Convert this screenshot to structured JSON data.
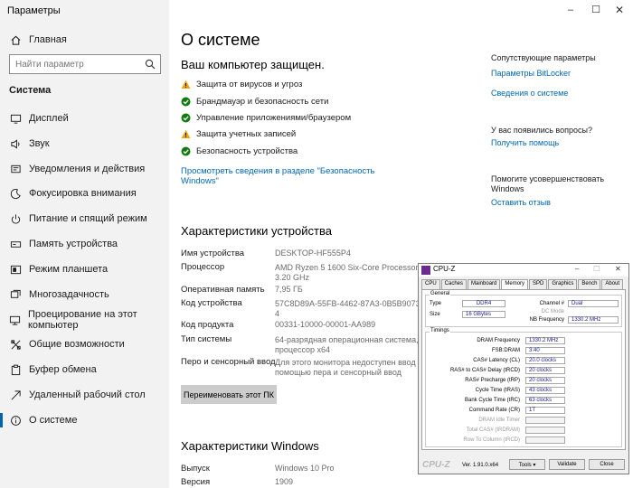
{
  "window": {
    "title": "Параметры",
    "min": "–",
    "max": "☐",
    "close": "✕"
  },
  "sidebar": {
    "home": "Главная",
    "search_placeholder": "Найти параметр",
    "section": "Система",
    "items": [
      {
        "label": "Дисплей",
        "icon": "display-icon"
      },
      {
        "label": "Звук",
        "icon": "sound-icon"
      },
      {
        "label": "Уведомления и действия",
        "icon": "notifications-icon"
      },
      {
        "label": "Фокусировка внимания",
        "icon": "focus-assist-icon"
      },
      {
        "label": "Питание и спящий режим",
        "icon": "power-icon"
      },
      {
        "label": "Память устройства",
        "icon": "storage-icon"
      },
      {
        "label": "Режим планшета",
        "icon": "tablet-mode-icon"
      },
      {
        "label": "Многозадачность",
        "icon": "multitasking-icon"
      },
      {
        "label": "Проецирование на этот компьютер",
        "icon": "projecting-icon"
      },
      {
        "label": "Общие возможности",
        "icon": "shared-experiences-icon"
      },
      {
        "label": "Буфер обмена",
        "icon": "clipboard-icon"
      },
      {
        "label": "Удаленный рабочий стол",
        "icon": "remote-desktop-icon"
      },
      {
        "label": "О системе",
        "icon": "about-icon"
      }
    ]
  },
  "main": {
    "title": "О системе",
    "protected_heading": "Ваш компьютер защищен.",
    "protection": [
      {
        "label": "Защита от вирусов и угроз",
        "status": "warning"
      },
      {
        "label": "Брандмауэр и безопасность сети",
        "status": "ok"
      },
      {
        "label": "Управление приложениями/браузером",
        "status": "ok"
      },
      {
        "label": "Защита учетных записей",
        "status": "warning"
      },
      {
        "label": "Безопасность устройства",
        "status": "ok"
      }
    ],
    "security_link_line1": "Просмотреть сведения в разделе \"Безопасность",
    "security_link_line2": "Windows\"",
    "device_heading": "Характеристики устройства",
    "specs": {
      "name_k": "Имя устройства",
      "name_v": "DESKTOP-HF555P4",
      "cpu_k": "Процессор",
      "cpu_v1": "AMD Ryzen 5 1600 Six-Core Processor",
      "cpu_v2": "3.20 GHz",
      "ram_k": "Оперативная память",
      "ram_v": "7,95 ГБ",
      "devid_k": "Код устройства",
      "devid_v1": "57C8D89A-55FB-4462-87A3-0B5B9073E9B",
      "devid_v2": "4",
      "prod_k": "Код продукта",
      "prod_v": "00331-10000-00001-AA989",
      "type_k": "Тип системы",
      "type_v1": "64-разрядная операционная система,",
      "type_v2": "процессор x64",
      "pen_k": "Перо и сенсорный ввод",
      "pen_v1": "Для этого монитора недоступен ввод с",
      "pen_v2": "помощью пера и сенсорный ввод"
    },
    "rename_button": "Переименовать этот ПК",
    "windows_heading": "Характеристики Windows",
    "win": {
      "edition_k": "Выпуск",
      "edition_v": "Windows 10 Pro",
      "version_k": "Версия",
      "version_v": "1909"
    }
  },
  "right": {
    "related_heading": "Сопутствующие параметры",
    "bitlocker": "Параметры BitLocker",
    "system_info": "Сведения о системе",
    "question": "У вас появились вопросы?",
    "get_help": "Получить помощь",
    "improve1": "Помогите усовершенствовать",
    "improve2": "Windows",
    "feedback": "Оставить отзыв"
  },
  "cpuz": {
    "title": "CPU-Z",
    "min": "–",
    "max": "☐",
    "close": "✕",
    "tabs": [
      "CPU",
      "Caches",
      "Mainboard",
      "Memory",
      "SPD",
      "Graphics",
      "Bench",
      "About"
    ],
    "active_tab": "Memory",
    "general_label": "General",
    "type_k": "Type",
    "type_v": "DDR4",
    "size_k": "Size",
    "size_v": "16 GBytes",
    "channel_k": "Channel #",
    "channel_v": "Dual",
    "dcmode_k": "DC Mode",
    "nbfreq_k": "NB Frequency",
    "nbfreq_v": "1330.2 MHz",
    "timings_label": "Timings",
    "timings": [
      {
        "k": "DRAM Frequency",
        "v": "1330.2 MHz",
        "dis": false
      },
      {
        "k": "FSB:DRAM",
        "v": "3:40",
        "dis": false
      },
      {
        "k": "CAS# Latency (CL)",
        "v": "20.0 clocks",
        "dis": false
      },
      {
        "k": "RAS# to CAS# Delay (tRCD)",
        "v": "20 clocks",
        "dis": false
      },
      {
        "k": "RAS# Precharge (tRP)",
        "v": "20 clocks",
        "dis": false
      },
      {
        "k": "Cycle Time (tRAS)",
        "v": "43 clocks",
        "dis": false
      },
      {
        "k": "Bank Cycle Time (tRC)",
        "v": "63 clocks",
        "dis": false
      },
      {
        "k": "Command Rate (CR)",
        "v": "1T",
        "dis": false
      },
      {
        "k": "DRAM Idle Timer",
        "v": "",
        "dis": true
      },
      {
        "k": "Total CAS# (tRDRAM)",
        "v": "",
        "dis": true
      },
      {
        "k": "Row To Column (tRCD)",
        "v": "",
        "dis": true
      }
    ],
    "logo": "CPU-Z",
    "version": "Ver. 1.91.0.x64",
    "tools": "Tools",
    "validate": "Validate",
    "close_btn": "Close"
  }
}
